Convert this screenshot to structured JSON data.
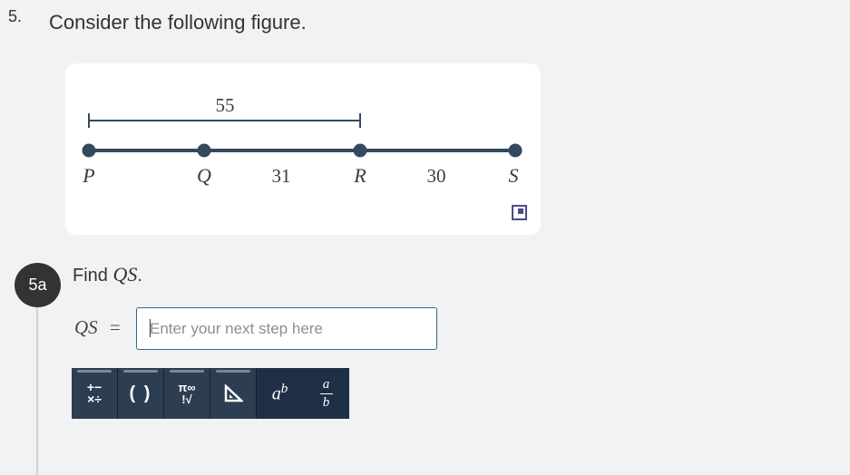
{
  "question": {
    "number": "5.",
    "title": "Consider the following figure."
  },
  "figure": {
    "brace_label": "55",
    "points": [
      "P",
      "Q",
      "R",
      "S"
    ],
    "segment_labels": {
      "QR": "31",
      "RS": "30"
    },
    "colors": {
      "line": "#34495e",
      "text": "#3c3c3c"
    }
  },
  "part": {
    "badge": "5a",
    "prompt_prefix": "Find",
    "prompt_math": "QS",
    "prompt_suffix": "."
  },
  "answer": {
    "label_var": "QS",
    "label_eq": "=",
    "placeholder": "Enter your next step here",
    "value": ""
  },
  "toolbar": {
    "buttons": [
      {
        "icon": "operators-icon",
        "l1": "+−",
        "l2": "×÷"
      },
      {
        "icon": "parentheses-icon",
        "label": "( )"
      },
      {
        "icon": "pi-infinity-icon",
        "l1": "π∞",
        "l2": "!√"
      },
      {
        "icon": "triangle-icon"
      },
      {
        "icon": "exponent-icon",
        "base": "a",
        "exp": "b"
      },
      {
        "icon": "fraction-icon",
        "num": "a",
        "den": "b"
      }
    ],
    "colors": {
      "bg": "#1f2f45",
      "button": "#2d3d52"
    }
  }
}
